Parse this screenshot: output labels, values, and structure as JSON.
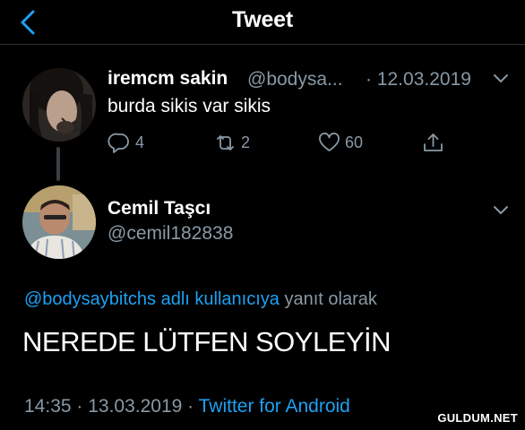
{
  "header": {
    "title": "Tweet",
    "back_icon": "chevron-left-icon",
    "accent": "#1da1f2"
  },
  "tweet1": {
    "name": "iremcm sakin",
    "handle": "@bodysa...",
    "date": "· 12.03.2019",
    "text": "burda sikis var sikis",
    "replies": "4",
    "retweets": "2",
    "likes": "60"
  },
  "tweet2": {
    "name": "Cemil Taşcı",
    "handle": "@cemil182838",
    "reply_mention": "@bodysaybitchs adlı kullanıcıya",
    "reply_suffix": " yanıt olarak",
    "text": "NEREDE LÜTFEN SOYLEYİN",
    "time": "14:35 · 13.03.2019 · ",
    "source": "Twitter for Android"
  },
  "watermark": "GULDUM.NET",
  "colors": {
    "background": "#000000",
    "muted": "#8899a6",
    "link": "#1da1f2"
  }
}
